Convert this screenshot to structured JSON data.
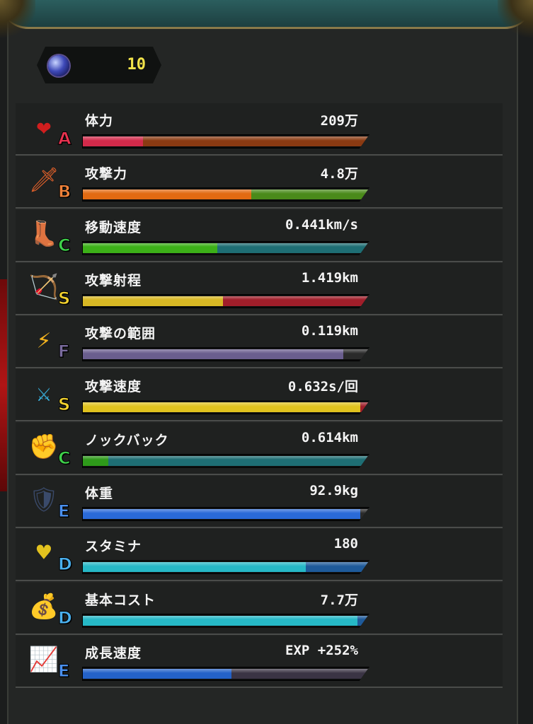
{
  "currency": {
    "icon": "blue-orb-icon",
    "value": "10"
  },
  "grade_colors": {
    "A": "#e8324f",
    "B": "#f0823a",
    "C": "#3ed04a",
    "S": "#f3d22e",
    "F": "#7a6b9e",
    "E": "#4a90ee",
    "D": "#4ab0ee"
  },
  "stats": [
    {
      "id": "hp",
      "icon": "heart-icon",
      "glyph": "❤",
      "iconColor": "#d01e1e",
      "grade": "A",
      "label": "体力",
      "value": "209万",
      "fill": 0.21,
      "fillColor": "#d22a4a",
      "restColor": "#8a3a12"
    },
    {
      "id": "attack",
      "icon": "sword-icon",
      "glyph": "🗡",
      "iconColor": "#e0602a",
      "grade": "B",
      "label": "攻撃力",
      "value": "4.8万",
      "fill": 0.59,
      "fillColor": "#e26a12",
      "restColor": "#4a8a1a"
    },
    {
      "id": "move-speed",
      "icon": "boot-icon",
      "glyph": "👢",
      "iconColor": "#9a6a3a",
      "grade": "C",
      "label": "移動速度",
      "value": "0.441km/s",
      "fill": 0.47,
      "fillColor": "#3cb018",
      "restColor": "#1e6e74"
    },
    {
      "id": "attack-range",
      "icon": "crossbow-icon",
      "glyph": "🏹",
      "iconColor": "#7ab834",
      "grade": "S",
      "label": "攻撃射程",
      "value": "1.419km",
      "fill": 0.49,
      "fillColor": "#d8b824",
      "restColor": "#a01e2a"
    },
    {
      "id": "attack-area",
      "icon": "lightning-icon",
      "glyph": "⚡",
      "iconColor": "#f2b21e",
      "grade": "F",
      "label": "攻撃の範囲",
      "value": "0.119km",
      "fill": 0.91,
      "fillColor": "#6a5e8e",
      "restColor": "#2a2a2a"
    },
    {
      "id": "attack-speed",
      "icon": "fast-sword-icon",
      "glyph": "⚔",
      "iconColor": "#3ab8e8",
      "grade": "S",
      "label": "攻撃速度",
      "value": "0.632s/回",
      "fill": 0.97,
      "fillColor": "#e0c21e",
      "restColor": "#a01e2a"
    },
    {
      "id": "knockback",
      "icon": "fist-icon",
      "glyph": "✊",
      "iconColor": "#a05a3a",
      "grade": "C",
      "label": "ノックバック",
      "value": "0.614km",
      "fill": 0.09,
      "fillColor": "#2e9a1a",
      "restColor": "#1e6e74"
    },
    {
      "id": "weight",
      "icon": "armor-icon",
      "glyph": "🛡",
      "iconColor": "#3a4a6a",
      "grade": "E",
      "label": "体重",
      "value": "92.9kg",
      "fill": 0.97,
      "fillColor": "#2a6ad8",
      "restColor": "#2a2a2a"
    },
    {
      "id": "stamina",
      "icon": "gold-heart-icon",
      "glyph": "♥",
      "iconColor": "#e2c21e",
      "grade": "D",
      "label": "スタミナ",
      "value": "180",
      "fill": 0.78,
      "fillColor": "#26b8c6",
      "restColor": "#1e5a9a"
    },
    {
      "id": "base-cost",
      "icon": "coin-bag-icon",
      "glyph": "💰",
      "iconColor": "#c8a23a",
      "grade": "D",
      "label": "基本コスト",
      "value": "7.7万",
      "fill": 0.96,
      "fillColor": "#26b8c6",
      "restColor": "#1e5a9a"
    },
    {
      "id": "growth-speed",
      "icon": "growth-book-icon",
      "glyph": "📈",
      "iconColor": "#d84a3a",
      "grade": "E",
      "label": "成長速度",
      "value": "EXP +252%",
      "fill": 0.52,
      "fillColor": "#2462c8",
      "restColor": "#3a3444"
    }
  ]
}
